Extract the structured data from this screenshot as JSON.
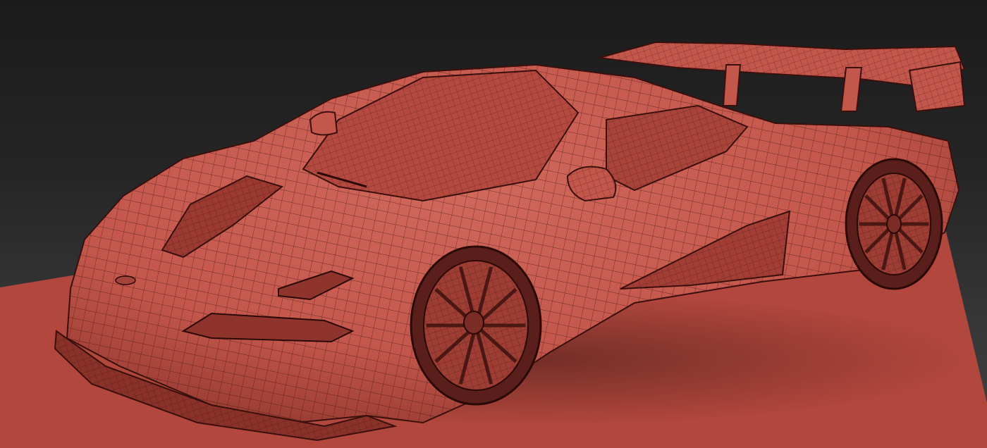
{
  "viewport": {
    "colors": {
      "background_top": "#1b1b1b",
      "background_bottom": "#404040",
      "ground_plane": "#b2473d",
      "model_surface": "#c4574b",
      "model_shadow": "#7a2c25",
      "wireframe": "#3a0f0c"
    },
    "model": {
      "render_mode": "shaded-wireframe",
      "subject": "car-model"
    }
  }
}
